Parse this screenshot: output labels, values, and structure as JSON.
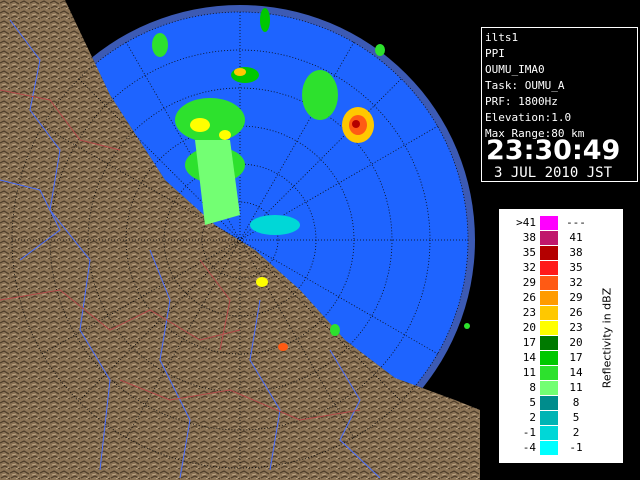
{
  "info": {
    "site": "ilts1",
    "product": "PPI",
    "task_id": "OUMU_IMA0",
    "task": "Task: OUMU_A",
    "prf": "PRF: 1800Hz",
    "elevation": "Elevation:1.0",
    "max_range": "Max Range:80 km",
    "time": "23:30:49",
    "date": "3 JUL 2010 JST"
  },
  "legend": {
    "title": "Reflectivity in dBZ",
    "rows": [
      {
        "lo": ">41",
        "hi": "---",
        "color": "#ff00ff"
      },
      {
        "lo": "38",
        "hi": "41",
        "color": "#c0176c"
      },
      {
        "lo": "35",
        "hi": "38",
        "color": "#b40000"
      },
      {
        "lo": "32",
        "hi": "35",
        "color": "#ff1a1a"
      },
      {
        "lo": "29",
        "hi": "32",
        "color": "#ff5a14"
      },
      {
        "lo": "26",
        "hi": "29",
        "color": "#ff9b00"
      },
      {
        "lo": "23",
        "hi": "26",
        "color": "#ffc800"
      },
      {
        "lo": "20",
        "hi": "23",
        "color": "#ffff00"
      },
      {
        "lo": "17",
        "hi": "20",
        "color": "#007a00"
      },
      {
        "lo": "14",
        "hi": "17",
        "color": "#00c800"
      },
      {
        "lo": "11",
        "hi": "14",
        "color": "#2de12d"
      },
      {
        "lo": "8",
        "hi": "11",
        "color": "#73ff73"
      },
      {
        "lo": "5",
        "hi": "8",
        "color": "#008c8c"
      },
      {
        "lo": "2",
        "hi": "5",
        "color": "#00b4b4"
      },
      {
        "lo": "-1",
        "hi": "2",
        "color": "#00d7d7"
      },
      {
        "lo": "-4",
        "hi": "-1",
        "color": "#00ffff"
      }
    ]
  },
  "map": {
    "sea_color": "#1e64ff",
    "outer_ring_color": "#3c5ab4",
    "land_color": "#8b7355",
    "range_ring_color": "#000000"
  }
}
